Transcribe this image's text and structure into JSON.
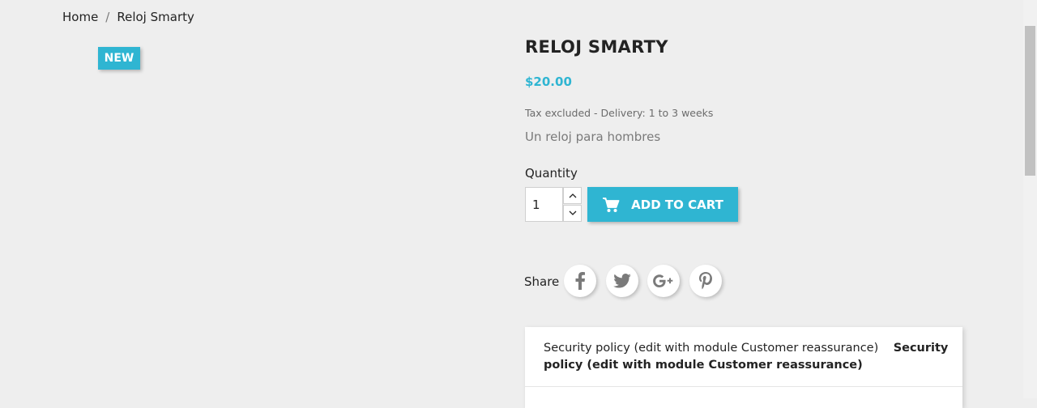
{
  "breadcrumb": {
    "items": [
      "Home",
      "Reloj Smarty"
    ],
    "separator": "/"
  },
  "badge": {
    "label": "NEW"
  },
  "product": {
    "title": "RELOJ SMARTY",
    "price": "$20.00",
    "tax_info": "Tax excluded - Delivery: 1 to 3 weeks",
    "description": "Un reloj para hombres"
  },
  "quantity": {
    "label": "Quantity",
    "value": "1"
  },
  "cart": {
    "button_label": "ADD TO CART",
    "icon": "shopping-cart-icon"
  },
  "share": {
    "label": "Share",
    "networks": [
      "facebook",
      "twitter",
      "google-plus",
      "pinterest"
    ]
  },
  "reassurance": {
    "image_alt": "Security policy (edit with module Customer reassurance)",
    "title": "Security policy (edit with module Customer reassurance)"
  },
  "colors": {
    "accent": "#2fb5d2",
    "background": "#eeeeee",
    "text": "#232323"
  }
}
